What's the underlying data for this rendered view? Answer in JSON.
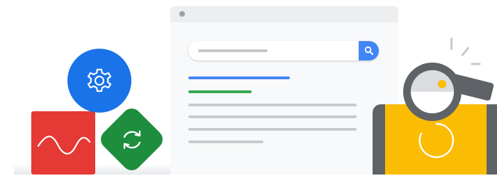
{
  "illustration": {
    "browser": {
      "search_placeholder": "",
      "search_icon": "search-icon"
    },
    "left_cluster": {
      "icons": [
        "settings-gear-icon",
        "sync-arrows-icon",
        "waveform-icon"
      ]
    },
    "right_cluster": {
      "icons": [
        "magnifier-icon",
        "loading-ring-icon"
      ]
    },
    "colors": {
      "blue": "#4285f4",
      "dark_blue": "#1a73e8",
      "green": "#34a853",
      "dark_green": "#1e8e3e",
      "red": "#e53935",
      "yellow": "#fbbc04",
      "gray": "#5f6368",
      "light_gray": "#c7cacc"
    }
  }
}
